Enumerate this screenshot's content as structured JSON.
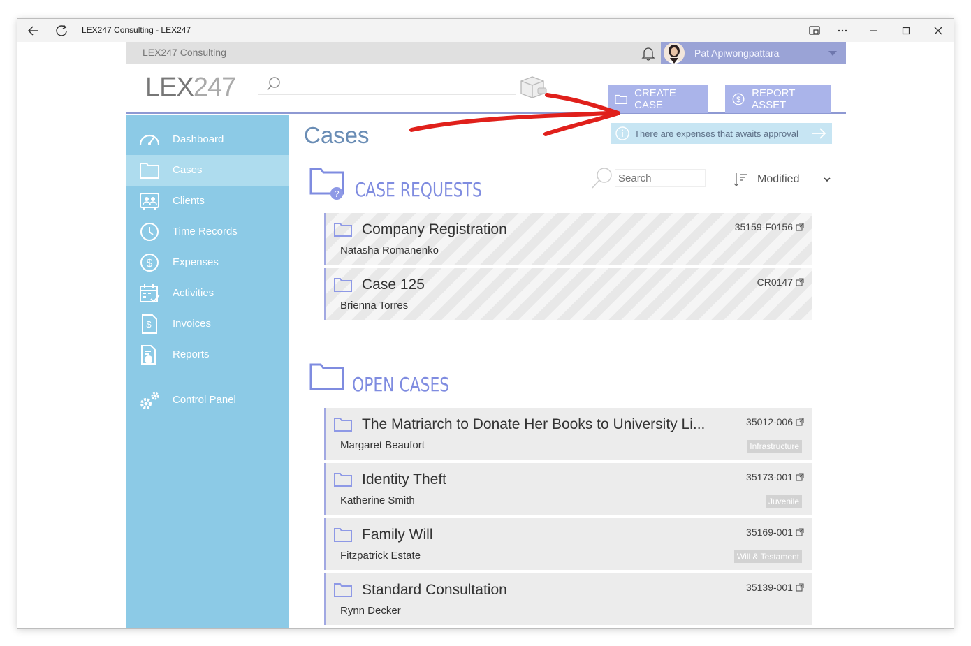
{
  "window": {
    "title": "LEX247 Consulting - LEX247"
  },
  "topbar": {
    "org_name": "LEX247 Consulting",
    "user_name": "Pat Apiwongpattara"
  },
  "header": {
    "logo_bold": "LEX",
    "logo_thin": "247",
    "search_placeholder": "",
    "create_case_label": "CREATE CASE",
    "report_asset_label": "REPORT ASSET"
  },
  "sidebar": {
    "items": [
      {
        "label": "Dashboard",
        "icon": "dashboard-gauge-icon"
      },
      {
        "label": "Cases",
        "icon": "folder-icon"
      },
      {
        "label": "Clients",
        "icon": "clients-icon"
      },
      {
        "label": "Time Records",
        "icon": "clock-icon"
      },
      {
        "label": "Expenses",
        "icon": "dollar-icon"
      },
      {
        "label": "Activities",
        "icon": "calendar-icon"
      },
      {
        "label": "Invoices",
        "icon": "invoice-icon"
      },
      {
        "label": "Reports",
        "icon": "report-icon"
      },
      {
        "label": "Control Panel",
        "icon": "gears-icon"
      }
    ],
    "active": "Cases"
  },
  "main": {
    "title": "Cases",
    "notice": "There are expenses that awaits approval",
    "filter": {
      "search_placeholder": "Search",
      "sort_value": "Modified"
    },
    "case_requests": {
      "title": "CASE REQUESTS",
      "items": [
        {
          "title": "Company Registration",
          "client": "Natasha Romanenko",
          "code": "35159-F0156"
        },
        {
          "title": "Case 125",
          "client": "Brienna Torres",
          "code": "CR0147"
        }
      ]
    },
    "open_cases": {
      "title": "OPEN CASES",
      "items": [
        {
          "title": "The Matriarch to Donate Her Books to University Li...",
          "client": "Margaret Beaufort",
          "code": "35012-006",
          "tag": "Infrastructure"
        },
        {
          "title": "Identity Theft",
          "client": "Katherine Smith",
          "code": "35173-001",
          "tag": "Juvenile"
        },
        {
          "title": "Family Will",
          "client": "Fitzpatrick Estate",
          "code": "35169-001",
          "tag": "Will & Testament"
        },
        {
          "title": "Standard Consultation",
          "client": "Rynn Decker",
          "code": "35139-001",
          "tag": ""
        }
      ]
    }
  },
  "colors": {
    "sidebar_bg": "#8ccae6",
    "sidebar_active": "#aedcee",
    "accent_button": "#aab4ea",
    "section_title": "#7f8ce0",
    "annotation_arrow": "#e0201b"
  }
}
